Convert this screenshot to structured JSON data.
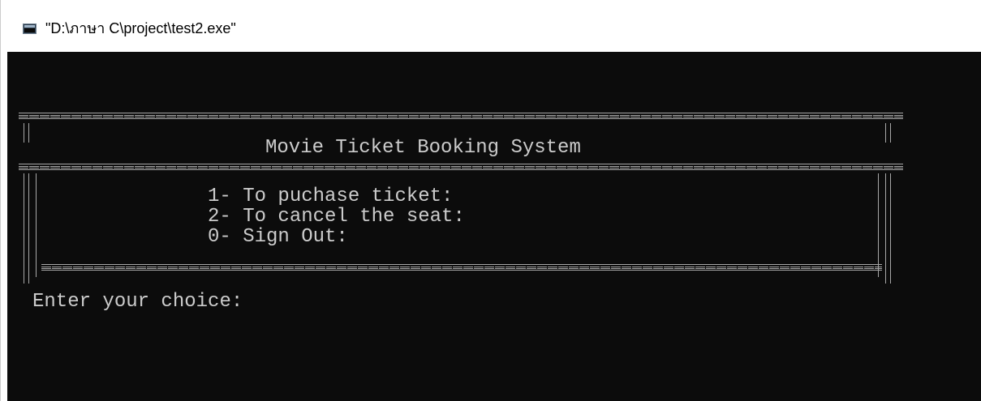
{
  "window": {
    "title": "\"D:\\ภาษา C\\project\\test2.exe\""
  },
  "console": {
    "header_title": "Movie Ticket Booking System",
    "menu_items": [
      "1- To puchase ticket:",
      "2- To cancel the seat:",
      "0- Sign Out:"
    ],
    "prompt": "Enter your choice:"
  },
  "colors": {
    "console_background": "#0c0c0c",
    "console_text": "#cccccc"
  },
  "icons": {
    "app": "console-window-icon"
  }
}
